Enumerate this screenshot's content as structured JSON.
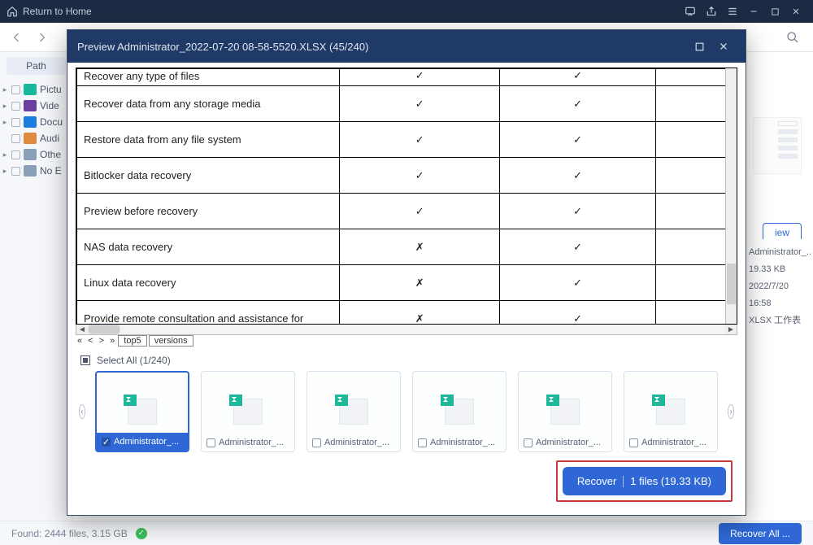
{
  "titlebar": {
    "home": "Return to Home"
  },
  "sidebar": {
    "path_tab": "Path",
    "items": [
      {
        "label": "Pictu"
      },
      {
        "label": "Vide"
      },
      {
        "label": "Docu"
      },
      {
        "label": "Audi"
      },
      {
        "label": "Othe"
      },
      {
        "label": "No E"
      }
    ]
  },
  "background": {
    "view_button": "iew",
    "details": {
      "name": "Administrator_..",
      "size": "19.33 KB",
      "date": "2022/7/20 16:58",
      "type": "XLSX 工作表"
    },
    "status_found": "Found: 2444 files, 3.15 GB",
    "recover_all": "Recover All ..."
  },
  "modal": {
    "title": "Preview Administrator_2022-07-20 08-58-5520.XLSX (45/240)",
    "table": [
      {
        "feature": "Recover any type of files",
        "a": "✓",
        "b": "✓",
        "c": ""
      },
      {
        "feature": "Recover data from any storage media",
        "a": "✓",
        "b": "✓",
        "c": ""
      },
      {
        "feature": "Restore data from any file system",
        "a": "✓",
        "b": "✓",
        "c": ""
      },
      {
        "feature": "Bitlocker data recovery",
        "a": "✓",
        "b": "✓",
        "c": ""
      },
      {
        "feature": "Preview before recovery",
        "a": "✓",
        "b": "✓",
        "c": ""
      },
      {
        "feature": "NAS data recovery",
        "a": "✗",
        "b": "✓",
        "c": ""
      },
      {
        "feature": "Linux data recovery",
        "a": "✗",
        "b": "✓",
        "c": ""
      },
      {
        "feature": "Provide remote consultation and assistance for",
        "a": "✗",
        "b": "✓",
        "c": ""
      }
    ],
    "sheet_tabs": {
      "nav": "« < > »",
      "tab1": "top5",
      "tab2": "versions"
    },
    "select_all": "Select All (1/240)",
    "thumbs": [
      {
        "label": "Administrator_...",
        "selected": true
      },
      {
        "label": "Administrator_...",
        "selected": false
      },
      {
        "label": "Administrator_...",
        "selected": false
      },
      {
        "label": "Administrator_...",
        "selected": false
      },
      {
        "label": "Administrator_...",
        "selected": false
      },
      {
        "label": "Administrator_...",
        "selected": false
      }
    ],
    "recover": {
      "action": "Recover",
      "info": "1 files (19.33 KB)"
    }
  }
}
